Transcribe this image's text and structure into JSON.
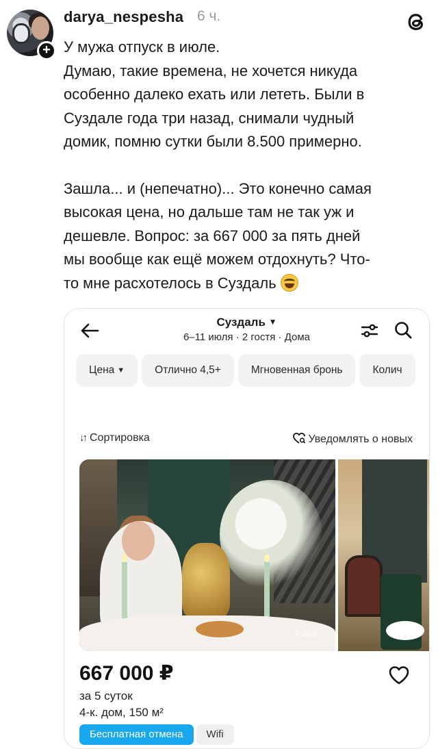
{
  "post": {
    "username": "darya_nespesha",
    "time": "6 ч.",
    "lines_part1": [
      "У мужа отпуск в июле.",
      "Думаю, такие времена, не хочется никуда",
      "особенно далеко ехать или лететь. Были в",
      "Суздале года три назад, снимали чудный",
      "домик, помню сутки были 8.500 примерно."
    ],
    "lines_part2": [
      "Зашла... и (непечатно)... Это конечно самая",
      "высокая цена, но дальше там не так уж и",
      "дешевле. Вопрос: за 667 000 за пять дней",
      "мы вообще как ещё можем отдохнуть? Что-",
      "то мне расхотелось в Суздаль"
    ],
    "emoji": "face-with-tears-of-joy",
    "icons": {
      "avatar": "profile-photo",
      "add": "plus-icon",
      "app": "threads-icon"
    }
  },
  "app": {
    "location": "Суздаль",
    "subtitle": "6–11 июля · 2 гостя · Дома",
    "filters": [
      "Цена",
      "Отлично 4,5+",
      "Мгновенная бронь",
      "Колич"
    ],
    "sort_label": "Сортировка",
    "notify_label": "Уведомлять о новых",
    "listing": {
      "price": "667 000 ₽",
      "period": "за 5 суток",
      "details": "4-к. дом, 150 м²",
      "badges": [
        "Бесплатная отмена",
        "Wifi"
      ],
      "watermark": "Avito"
    },
    "colors": {
      "badge_blue": "#18a8f0",
      "chip_bg": "#f2f2f3"
    }
  }
}
